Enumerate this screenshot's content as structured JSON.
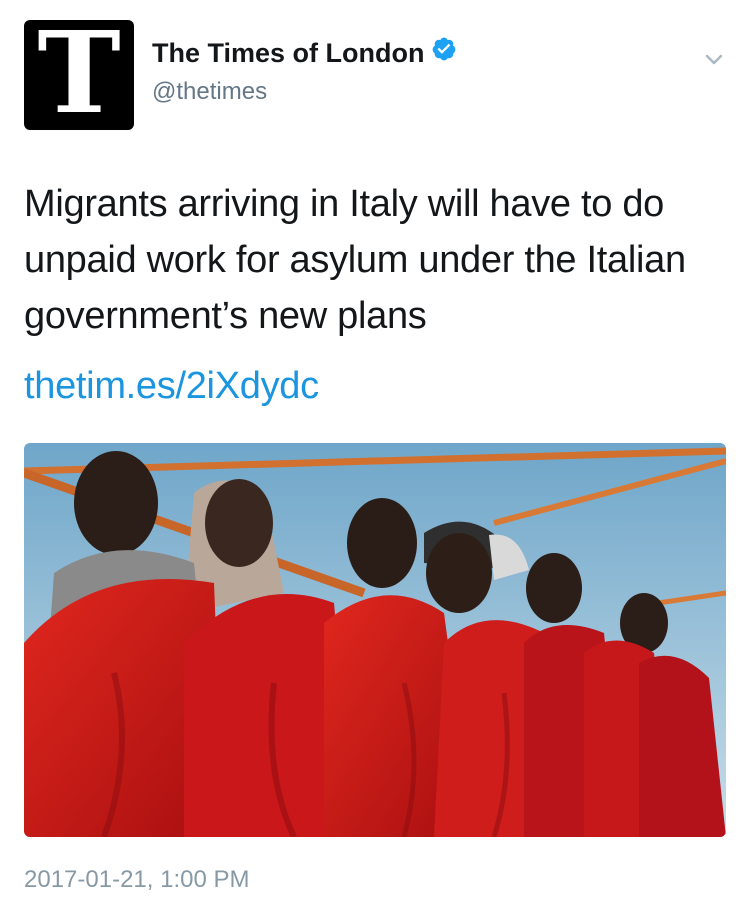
{
  "account": {
    "avatar_letter": "T",
    "display_name": "The Times of London",
    "handle": "@thetimes",
    "verified_color": "#1da1f2"
  },
  "tweet": {
    "text": "Migrants arriving in Italy will have to do unpaid work for asylum under the Italian government’s new plans",
    "link": "thetim.es/2iXdydc",
    "link_color": "#1b95e0",
    "timestamp": "2017-01-21, 1:00 PM"
  },
  "icons": {
    "verified": "verified-badge-icon",
    "menu": "chevron-down-icon"
  }
}
